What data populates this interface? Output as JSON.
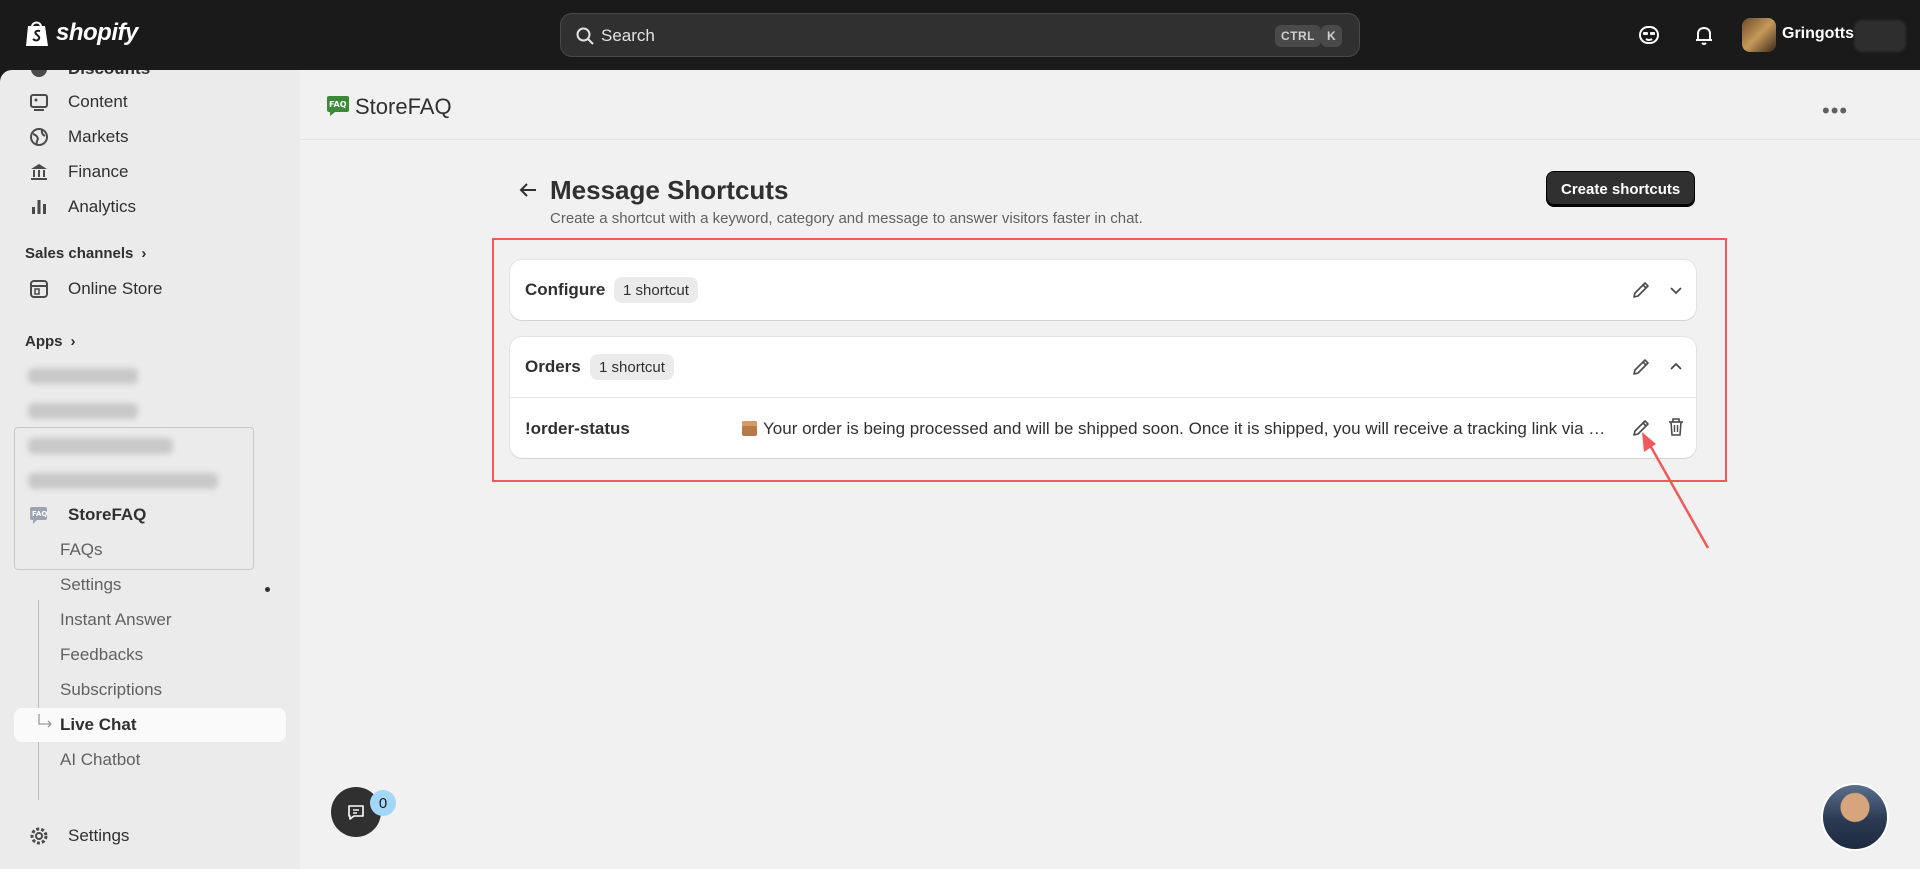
{
  "topbar": {
    "brand": "shopify",
    "search_placeholder": "Search",
    "shortcut_ctrl": "CTRL",
    "shortcut_k": "K",
    "store_name": "Gringotts",
    "icons": [
      "shopify-bag-icon",
      "search-icon",
      "support-icon",
      "bell-icon"
    ]
  },
  "sidebar": {
    "items": [
      {
        "label": "Discounts",
        "icon": "discount-icon"
      },
      {
        "label": "Content",
        "icon": "content-icon"
      },
      {
        "label": "Markets",
        "icon": "globe-icon"
      },
      {
        "label": "Finance",
        "icon": "bank-icon"
      },
      {
        "label": "Analytics",
        "icon": "bar-chart-icon"
      }
    ],
    "sales_channels_label": "Sales channels",
    "online_store_label": "Online Store",
    "apps_label": "Apps",
    "app_label": "StoreFAQ",
    "sub_items": [
      "FAQs",
      "Settings",
      "Instant Answer",
      "Feedbacks",
      "Subscriptions",
      "Live Chat",
      "AI Chatbot"
    ],
    "settings_label": "Settings"
  },
  "app_header": {
    "title": "StoreFAQ",
    "icon_text": "FAQ"
  },
  "page": {
    "title": "Message Shortcuts",
    "subtitle": "Create a shortcut with a keyword, category and message to answer visitors faster in chat.",
    "create_button": "Create shortcuts"
  },
  "categories": [
    {
      "name": "Configure",
      "badge": "1 shortcut",
      "expanded": false
    },
    {
      "name": "Orders",
      "badge": "1 shortcut",
      "expanded": true,
      "shortcuts": [
        {
          "keyword": "!order-status",
          "message": "Your order is being processed and will be shipped soon. Once it is shipped, you will receive a tracking link via email."
        }
      ]
    }
  ],
  "chat": {
    "count": "0"
  },
  "colors": {
    "highlight": "#f05a5a",
    "topbar": "#1a1a1a",
    "primary": "#303030"
  }
}
